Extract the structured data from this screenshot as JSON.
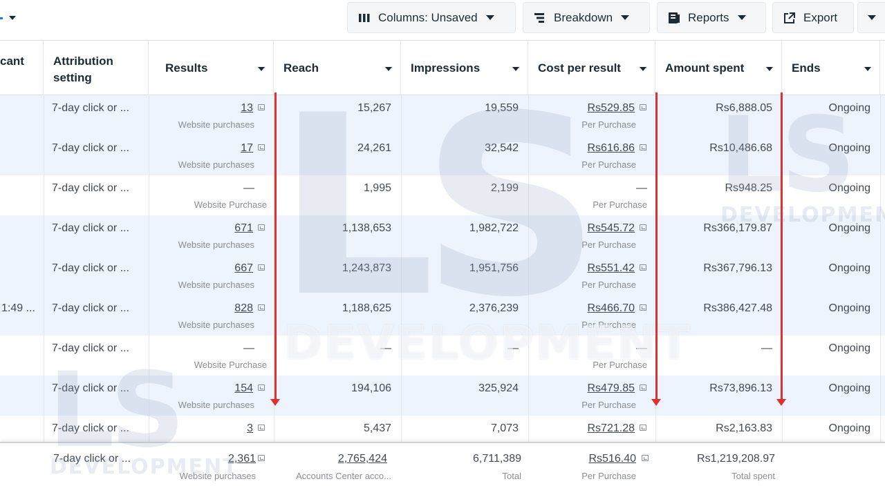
{
  "toolbar": {
    "columns_label": "Columns: Unsaved",
    "breakdown_label": "Breakdown",
    "reports_label": "Reports",
    "export_label": "Export"
  },
  "headers": {
    "partial": "cant",
    "attribution": "Attribution setting",
    "results": "Results",
    "reach": "Reach",
    "impressions": "Impressions",
    "cost_per_result": "Cost per result",
    "amount_spent": "Amount spent",
    "ends": "Ends"
  },
  "rows": [
    {
      "partial": "",
      "attribution": "7-day click or ...",
      "results": "13",
      "results_sub": "Website purchases",
      "reach": "15,267",
      "impressions": "19,559",
      "cpr": "Rs529.85",
      "cpr_sub": "Per Purchase",
      "spent": "Rs6,888.05",
      "ends": "Ongoing"
    },
    {
      "partial": "",
      "attribution": "7-day click or ...",
      "results": "17",
      "results_sub": "Website purchases",
      "reach": "24,261",
      "impressions": "32,542",
      "cpr": "Rs616.86",
      "cpr_sub": "Per Purchase",
      "spent": "Rs10,486.68",
      "ends": "Ongoing"
    },
    {
      "partial": "",
      "attribution": "7-day click or ...",
      "results": "—",
      "results_sub": "Website Purchase",
      "reach": "1,995",
      "impressions": "2,199",
      "cpr": "—",
      "cpr_sub": "Per Purchase",
      "spent": "Rs948.25",
      "ends": "Ongoing"
    },
    {
      "partial": "",
      "attribution": "7-day click or ...",
      "results": "671",
      "results_sub": "Website purchases",
      "reach": "1,138,653",
      "impressions": "1,982,722",
      "cpr": "Rs545.72",
      "cpr_sub": "Per Purchase",
      "spent": "Rs366,179.87",
      "ends": "Ongoing"
    },
    {
      "partial": "",
      "attribution": "7-day click or ...",
      "results": "667",
      "results_sub": "Website purchases",
      "reach": "1,243,873",
      "impressions": "1,951,756",
      "cpr": "Rs551.42",
      "cpr_sub": "Per Purchase",
      "spent": "Rs367,796.13",
      "ends": "Ongoing"
    },
    {
      "partial": "1:49 ...",
      "attribution": "7-day click or ...",
      "results": "828",
      "results_sub": "Website purchases",
      "reach": "1,188,625",
      "impressions": "2,376,239",
      "cpr": "Rs466.70",
      "cpr_sub": "Per Purchase",
      "spent": "Rs386,427.48",
      "ends": "Ongoing"
    },
    {
      "partial": "",
      "attribution": "7-day click or ...",
      "results": "—",
      "results_sub": "Website Purchase",
      "reach": "—",
      "impressions": "—",
      "cpr": "—",
      "cpr_sub": "Per Purchase",
      "spent": "—",
      "ends": "Ongoing"
    },
    {
      "partial": "",
      "attribution": "7-day click or ...",
      "results": "154",
      "results_sub": "Website purchases",
      "reach": "194,106",
      "impressions": "325,924",
      "cpr": "Rs479.85",
      "cpr_sub": "Per Purchase",
      "spent": "Rs73,896.13",
      "ends": "Ongoing"
    },
    {
      "partial": "",
      "attribution": "7-day click or ...",
      "results": "3",
      "results_sub": "",
      "reach": "5,437",
      "impressions": "7,073",
      "cpr": "Rs721.28",
      "cpr_sub": "",
      "spent": "Rs2,163.83",
      "ends": "Ongoing"
    }
  ],
  "totals": {
    "attribution": "7-day click or ...",
    "results": "2,361",
    "results_sub": "Website purchases",
    "reach": "2,765,424",
    "reach_sub": "Accounts Center acco...",
    "impressions": "6,711,389",
    "impressions_sub": "Total",
    "cpr": "Rs516.40",
    "cpr_sub": "Per Purchase",
    "spent": "Rs1,219,208.97",
    "spent_sub": "Total spent"
  },
  "watermark": {
    "big": "LS",
    "word": "DEVELOPMENT"
  },
  "colors": {
    "row_highlight": "#eef4fd",
    "annotation_arrow": "#e03131"
  }
}
